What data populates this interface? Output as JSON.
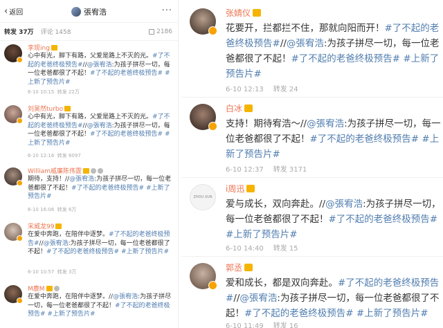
{
  "nav": {
    "back_label": "返回",
    "title": "張宥浩",
    "more": "···"
  },
  "stats": {
    "repost_label": "转发",
    "repost_count": "37万",
    "comment": "评论 1458",
    "likes": "2186"
  },
  "left_items": [
    {
      "name": "李现ing",
      "text_plain": "心中有光，脚下有路，父爱是路上不灭的光。",
      "tags1": "#了不起的老爸终极预告#",
      "mid": "//",
      "at": "@張宥浩",
      "mid2": ":为孩子拼尽一切，每一位老爸都很了不起！",
      "tags2": "#了不起的老爸终极预告# #上新了预告片#",
      "time": "6-10 10:15",
      "reposts": "转发 22万"
    },
    {
      "name": "刘昊然turbo",
      "text_plain": "心中有光，脚下有路，父爱是路上不灭的光。",
      "tags1": "#了不起的老爸终极预告#",
      "mid": "//",
      "at": "@張宥浩",
      "mid2": ":为孩子拼尽一切，每一位老爸都很了不起！",
      "tags2": "#了不起的老爸终极预告# #上新了预告片#",
      "time": "6-10 12:16",
      "reposts": "转发 6097"
    },
    {
      "name": "William威廉陈伟霆",
      "text_plain": "期待，支持！",
      "tags1": "",
      "mid": "//",
      "at": "@張宥浩",
      "mid2": ":为孩子拼尽一切，每一位老爸都很了不起！",
      "tags2": "#了不起的老爸终极预告# #上新了预告片#",
      "time": "6-10 16:06",
      "reposts": "转发 6万"
    },
    {
      "name": "宋威龙99",
      "text_plain": "在爱中奔跑，在陪伴中逐梦。",
      "tags1": "#了不起的老爸终极预告#",
      "mid": "//",
      "at": "@張宥浩",
      "mid2": ":为孩子拼尽一切，每一位老爸都很了不起！",
      "tags2": "#了不起的老爸终极预告# #上新了预告片#",
      "time": "6-10 10:57",
      "reposts": "转发 3万"
    },
    {
      "name": "M鹿M",
      "text_plain": "在爱中奔跑，在陪伴中逐梦。",
      "tags1": "",
      "mid": "//",
      "at": "@張宥浩",
      "mid2": ":为孩子拼尽一切，每一位老爸都很了不起！",
      "tags2": "#了不起的老爸终极预告# #上新了预告片#",
      "time": "",
      "reposts": ""
    }
  ],
  "right_items": [
    {
      "name": "张婧仪",
      "text_plain": "花要开，拦都拦不住，那就向阳而开！",
      "tags1": "#了不起的老爸终极预告#",
      "mid": "//",
      "at": "@張宥浩",
      "mid2": ":为孩子拼尽一切，每一位老爸都很了不起！",
      "tags2": "#了不起的老爸终极预告# #上新了预告片#",
      "time": "6-10 12:13",
      "reposts": "转发 24"
    },
    {
      "name": "白冰",
      "text_plain": "支持！期待宥浩～",
      "tags1": "",
      "mid": "//",
      "at": "@張宥浩",
      "mid2": ":为孩子拼尽一切，每一位老爸都很了不起！",
      "tags2": "#了不起的老爸终极预告# #上新了预告片#",
      "time": "6-10 12:37",
      "reposts": "转发 3171"
    },
    {
      "name": "i周迅",
      "text_plain": "爱与成长，双向奔赴。",
      "tags1": "",
      "mid": "//",
      "at": "@張宥浩",
      "mid2": ":为孩子拼尽一切，每一位老爸都很了不起！",
      "tags2": "#了不起的老爸终极预告# #上新了预告片#",
      "time": "6-10 14:40",
      "reposts": "转发 15",
      "avatar_text": "ZHOU XUN"
    },
    {
      "name": "郭丞",
      "text_plain": "爱和成长，都是双向奔赴。",
      "tags1": "#了不起的老爸终极预告#",
      "mid": "//",
      "at": "@張宥浩",
      "mid2": ":为孩子拼尽一切，每一位老爸都很了不起！",
      "tags2": "#了不起的老爸终极预告# #上新了预告片#",
      "time": "6-10 11:49",
      "reposts": "转发 16"
    }
  ],
  "colors": {
    "link": "#507daf",
    "name": "#eb7350",
    "badge": "#f7a300"
  }
}
